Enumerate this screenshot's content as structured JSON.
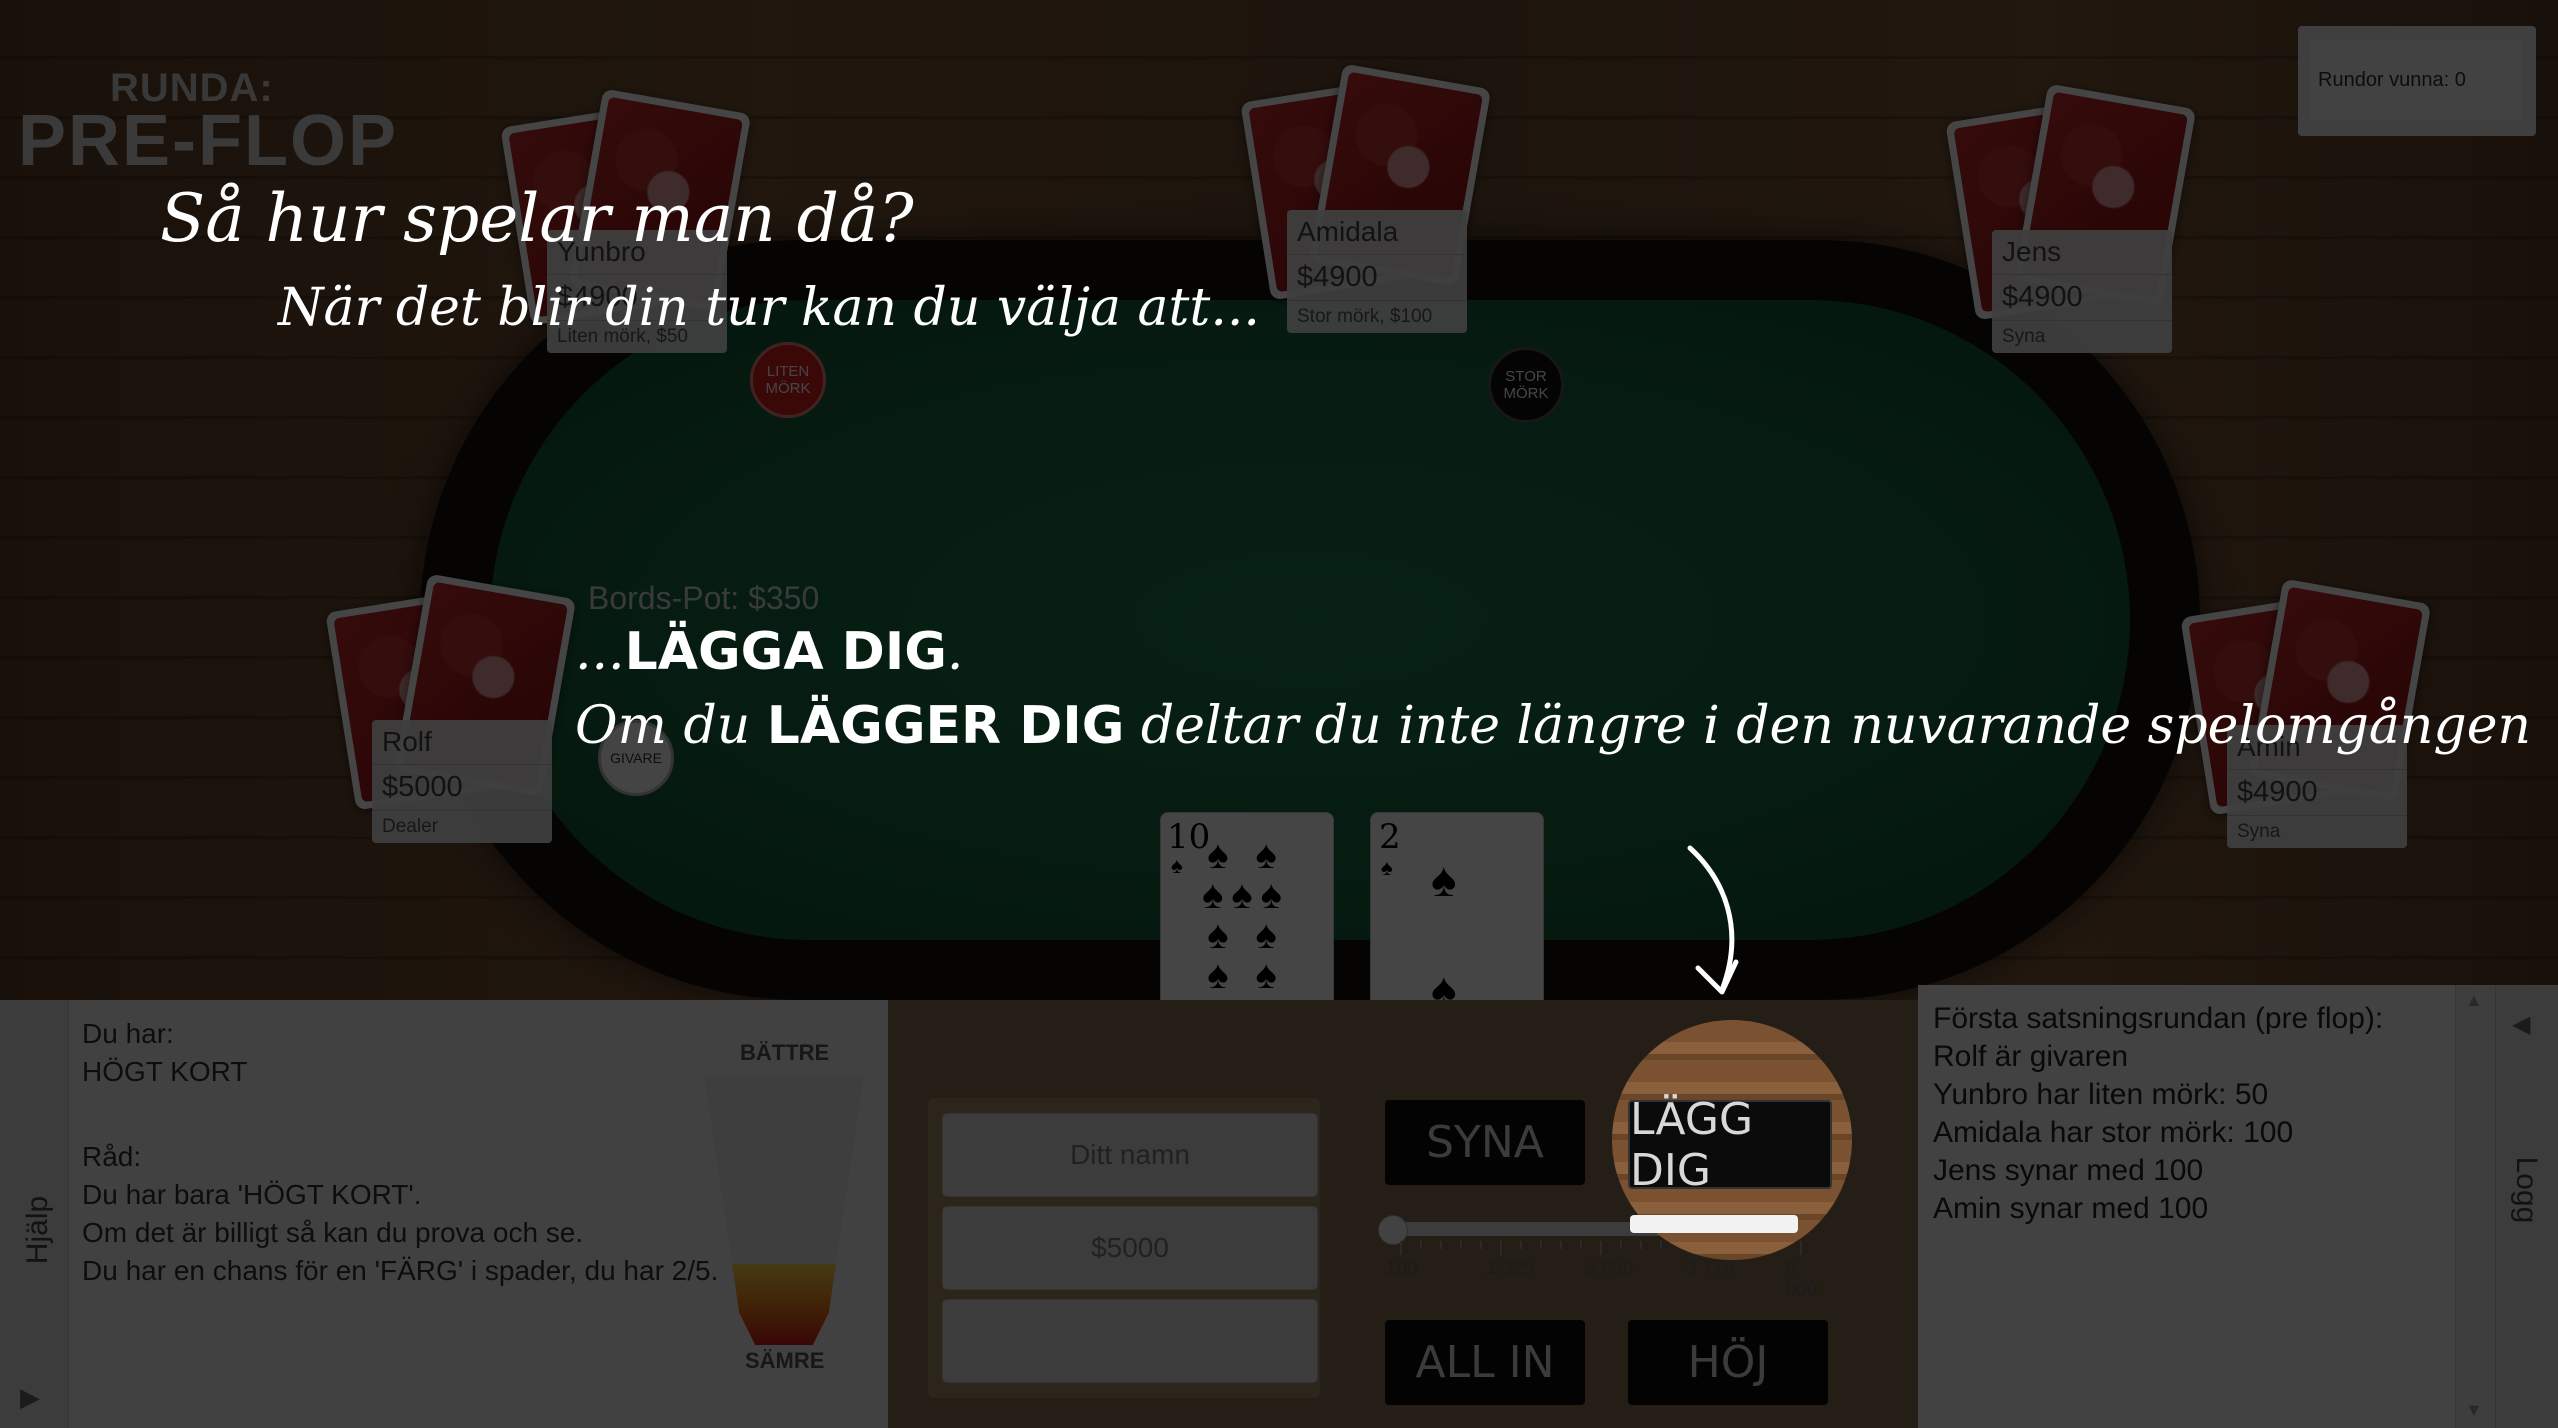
{
  "round": {
    "label": "RUNDA:",
    "phase": "PRE-FLOP"
  },
  "rounds_won": "Rundor vunna: 0",
  "players": {
    "yunbro": {
      "name": "Yunbro",
      "money": "$4900",
      "status": "Liten mörk, $50"
    },
    "amidala": {
      "name": "Amidala",
      "money": "$4900",
      "status": "Stor mörk, $100"
    },
    "jens": {
      "name": "Jens",
      "money": "$4900",
      "status": "Syna"
    },
    "rolf": {
      "name": "Rolf",
      "money": "$5000",
      "status": "Dealer"
    },
    "amin": {
      "name": "Amin",
      "money": "$4900",
      "status": "Syna"
    }
  },
  "chips": {
    "small_blind": "LITEN MÖRK",
    "big_blind": "STOR MÖRK",
    "dealer": "GIVARE"
  },
  "pot": "Bords-Pot: $350",
  "tutorial": {
    "heading": "Så hur spelar man då?",
    "subheading": "När det blir din tur kan du välja att...",
    "line1_prefix": "...",
    "line1_bold": "LÄGGA DIG",
    "line1_suffix": ".",
    "line2_pre": "Om du ",
    "line2_bold": "LÄGGER DIG",
    "line2_post": " deltar du inte längre i den nuvarande spelomgången"
  },
  "hand": [
    {
      "rank": "10",
      "suit": "spades"
    },
    {
      "rank": "2",
      "suit": "spades"
    }
  ],
  "player_box": {
    "name_placeholder": "Ditt namn",
    "money": "$5000",
    "extra": ""
  },
  "actions": {
    "call": "SYNA",
    "fold": "LÄGG DIG",
    "all_in": "ALL IN",
    "raise": "HÖJ"
  },
  "bet_slider": {
    "value": 100,
    "min": 100,
    "max": 5000,
    "tick_labels": [
      "100",
      "1 325",
      "2 550",
      "3 775",
      "5 000"
    ]
  },
  "help": {
    "tab_label": "Hjälp",
    "you_have_label": "Du har:",
    "hand_value": "HÖGT KORT",
    "advice_label": "Råd:",
    "advice": [
      "Du har bara 'HÖGT KORT'.",
      "Om det är billigt så kan du prova och se.",
      "Du har en chans för en 'FÄRG' i spader, du har 2/5."
    ],
    "meter_top": "BÄTTRE",
    "meter_bottom": "SÄMRE",
    "meter_level": 0.3
  },
  "log": {
    "tab_label": "Logg",
    "lines": [
      "Första satsningsrundan (pre flop):",
      "Rolf är givaren",
      "Yunbro har liten mörk: 50",
      "Amidala har stor mörk: 100",
      "Jens synar med 100",
      "Amin synar med 100"
    ]
  },
  "colors": {
    "felt": "#1f7a4d",
    "card_back": "#c52a2a",
    "chip_small": "#d92020",
    "chip_big": "#111111"
  }
}
